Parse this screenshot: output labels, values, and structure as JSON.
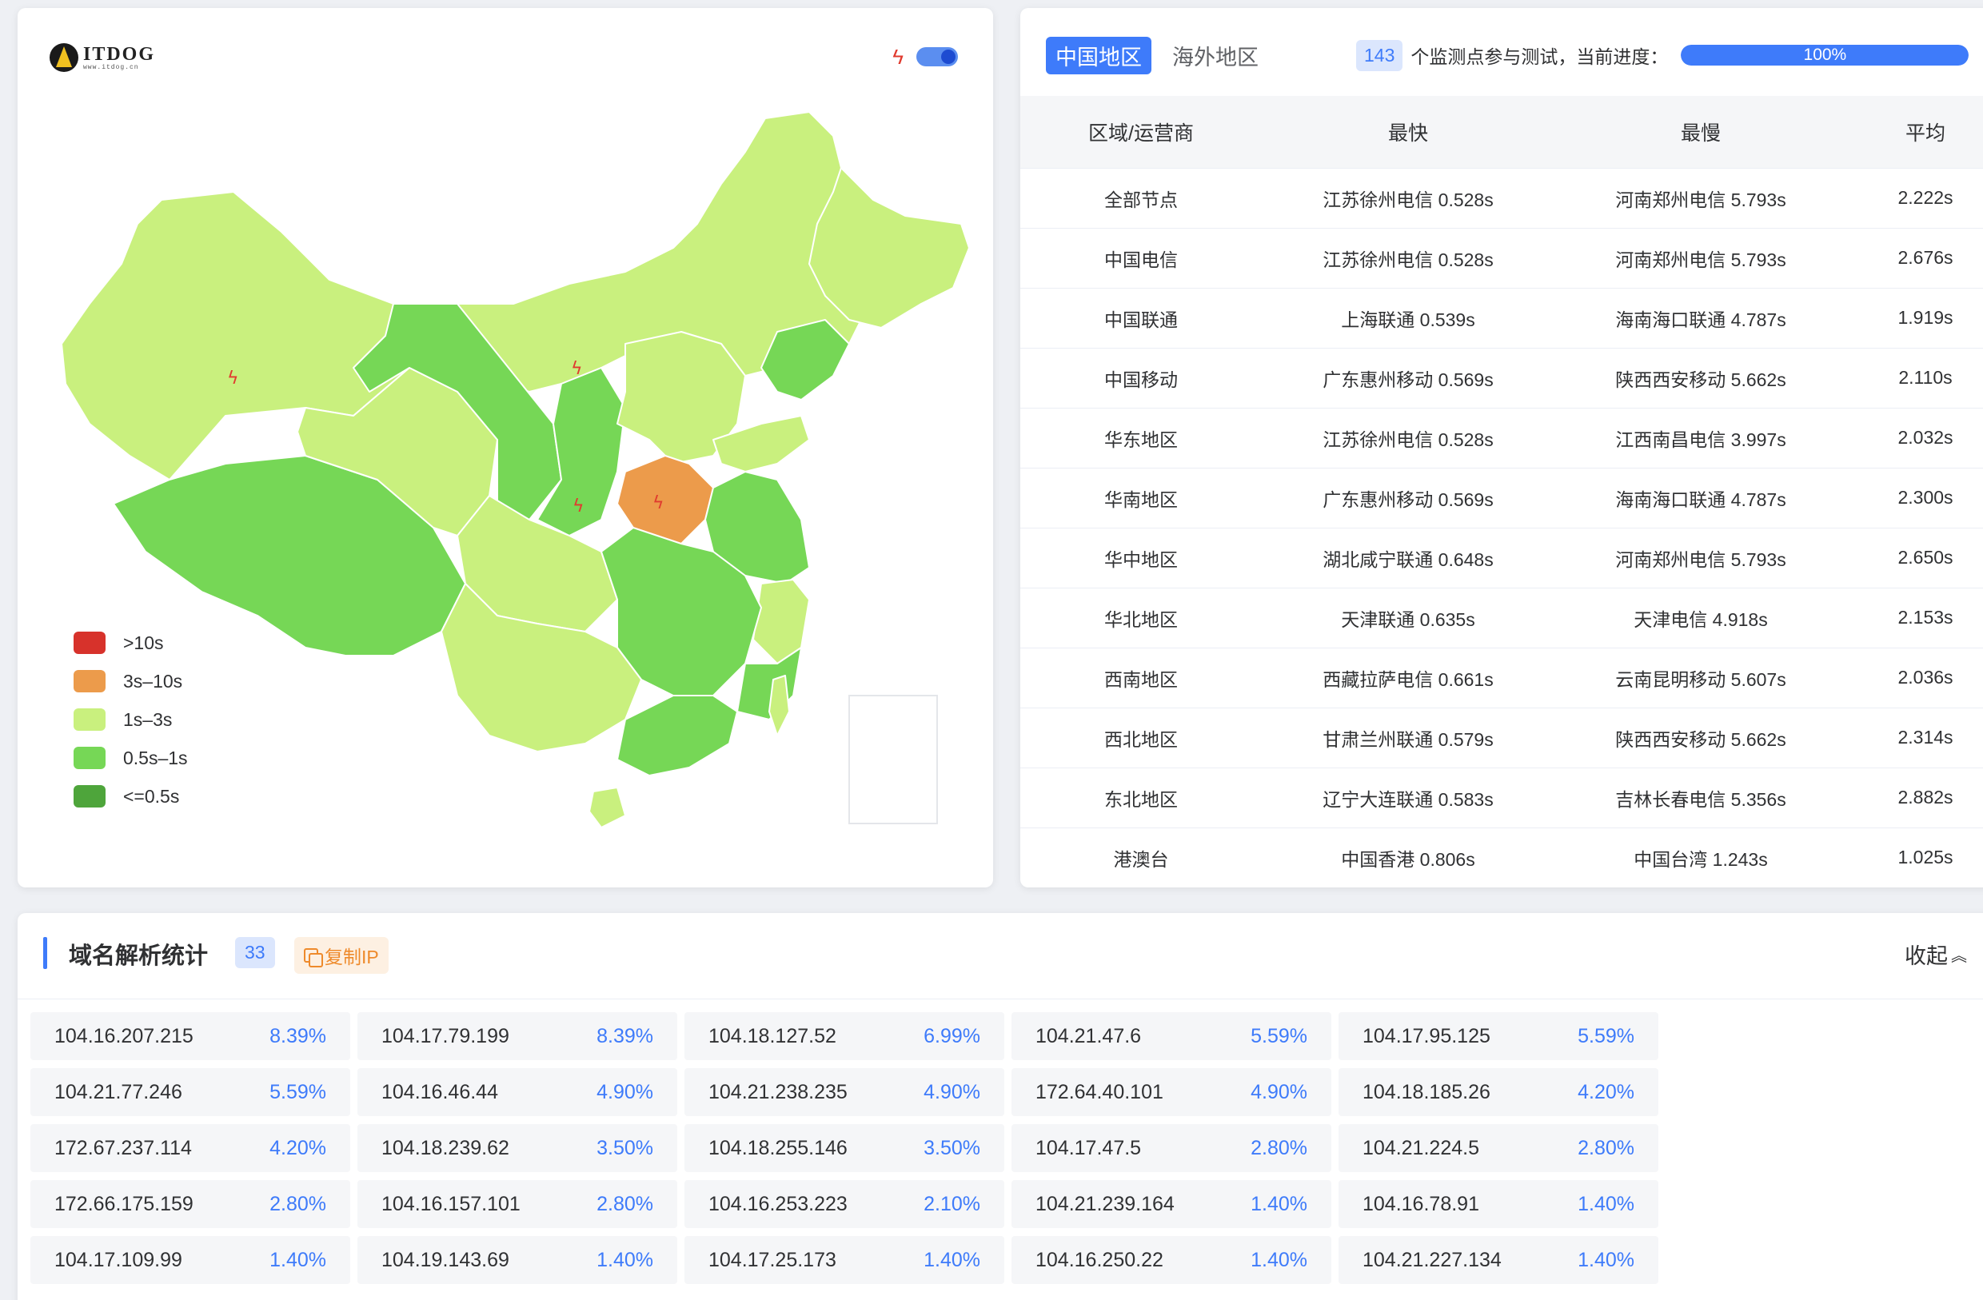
{
  "map": {
    "logo_text": "ITDOG",
    "logo_sub": "www.itdog.cn",
    "legend": [
      {
        "label": ">10s",
        "color": "#d7322b"
      },
      {
        "label": "3s–10s",
        "color": "#ec9b4b"
      },
      {
        "label": "1s–3s",
        "color": "#c9f07e"
      },
      {
        "label": "0.5s–1s",
        "color": "#76d756"
      },
      {
        "label": "<=0.5s",
        "color": "#4ea53b"
      }
    ]
  },
  "stats": {
    "tabs": [
      "中国地区",
      "海外地区"
    ],
    "monitor_count": "143",
    "progress_text": "个监测点参与测试，当前进度：",
    "progress_percent": 100,
    "progress_label": "100%",
    "columns": [
      "区域/运营商",
      "最快",
      "最慢",
      "平均"
    ],
    "rows": [
      [
        "全部节点",
        "江苏徐州电信 0.528s",
        "河南郑州电信 5.793s",
        "2.222s"
      ],
      [
        "中国电信",
        "江苏徐州电信 0.528s",
        "河南郑州电信 5.793s",
        "2.676s"
      ],
      [
        "中国联通",
        "上海联通 0.539s",
        "海南海口联通 4.787s",
        "1.919s"
      ],
      [
        "中国移动",
        "广东惠州移动 0.569s",
        "陕西西安移动 5.662s",
        "2.110s"
      ],
      [
        "华东地区",
        "江苏徐州电信 0.528s",
        "江西南昌电信 3.997s",
        "2.032s"
      ],
      [
        "华南地区",
        "广东惠州移动 0.569s",
        "海南海口联通 4.787s",
        "2.300s"
      ],
      [
        "华中地区",
        "湖北咸宁联通 0.648s",
        "河南郑州电信 5.793s",
        "2.650s"
      ],
      [
        "华北地区",
        "天津联通 0.635s",
        "天津电信 4.918s",
        "2.153s"
      ],
      [
        "西南地区",
        "西藏拉萨电信 0.661s",
        "云南昆明移动 5.607s",
        "2.036s"
      ],
      [
        "西北地区",
        "甘肃兰州联通 0.579s",
        "陕西西安移动 5.662s",
        "2.314s"
      ],
      [
        "东北地区",
        "辽宁大连联通 0.583s",
        "吉林长春电信 5.356s",
        "2.882s"
      ],
      [
        "港澳台",
        "中国香港 0.806s",
        "中国台湾 1.243s",
        "1.025s"
      ]
    ]
  },
  "dns": {
    "title": "域名解析统计",
    "count": "33",
    "copy_label": "复制IP",
    "collapse_label": "收起",
    "ips": [
      {
        "ip": "104.16.207.215",
        "pct": "8.39%"
      },
      {
        "ip": "104.17.79.199",
        "pct": "8.39%"
      },
      {
        "ip": "104.18.127.52",
        "pct": "6.99%"
      },
      {
        "ip": "104.21.47.6",
        "pct": "5.59%"
      },
      {
        "ip": "104.17.95.125",
        "pct": "5.59%"
      },
      {
        "ip": "104.21.77.246",
        "pct": "5.59%"
      },
      {
        "ip": "104.16.46.44",
        "pct": "4.90%"
      },
      {
        "ip": "104.21.238.235",
        "pct": "4.90%"
      },
      {
        "ip": "172.64.40.101",
        "pct": "4.90%"
      },
      {
        "ip": "104.18.185.26",
        "pct": "4.20%"
      },
      {
        "ip": "172.67.237.114",
        "pct": "4.20%"
      },
      {
        "ip": "104.18.239.62",
        "pct": "3.50%"
      },
      {
        "ip": "104.18.255.146",
        "pct": "3.50%"
      },
      {
        "ip": "104.17.47.5",
        "pct": "2.80%"
      },
      {
        "ip": "104.21.224.5",
        "pct": "2.80%"
      },
      {
        "ip": "172.66.175.159",
        "pct": "2.80%"
      },
      {
        "ip": "104.16.157.101",
        "pct": "2.80%"
      },
      {
        "ip": "104.16.253.223",
        "pct": "2.10%"
      },
      {
        "ip": "104.21.239.164",
        "pct": "1.40%"
      },
      {
        "ip": "104.16.78.91",
        "pct": "1.40%"
      },
      {
        "ip": "104.17.109.99",
        "pct": "1.40%"
      },
      {
        "ip": "104.19.143.69",
        "pct": "1.40%"
      },
      {
        "ip": "104.17.25.173",
        "pct": "1.40%"
      },
      {
        "ip": "104.16.250.22",
        "pct": "1.40%"
      },
      {
        "ip": "104.21.227.134",
        "pct": "1.40%"
      }
    ]
  }
}
